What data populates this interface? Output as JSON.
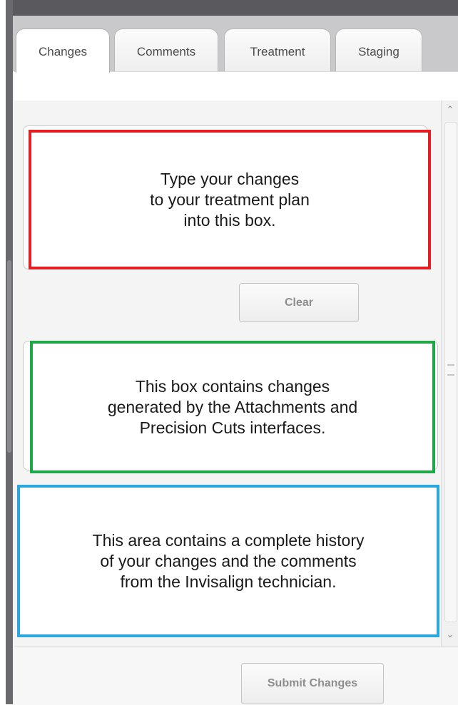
{
  "tabs": [
    {
      "label": "Changes",
      "active": true
    },
    {
      "label": "Comments",
      "active": false
    },
    {
      "label": "Treatment",
      "active": false
    },
    {
      "label": "Staging",
      "active": false
    }
  ],
  "changes_box": {
    "text": "Type your changes\nto your treatment plan\ninto this box.",
    "highlight_color": "#e31e24"
  },
  "clear_button": {
    "label": "Clear"
  },
  "generated_changes_box": {
    "text": "This box contains changes\ngenerated by the Attachments and\nPrecision Cuts interfaces.",
    "highlight_color": "#1fa84a"
  },
  "history_box": {
    "text": "This area contains a complete history\nof your changes and the comments\nfrom the Invisalign technician.",
    "highlight_color": "#2aa7dd"
  },
  "submit_button": {
    "label": "Submit Changes"
  },
  "scrollbar": {
    "up_icon": "chevron-up-icon",
    "down_icon": "chevron-down-icon"
  }
}
